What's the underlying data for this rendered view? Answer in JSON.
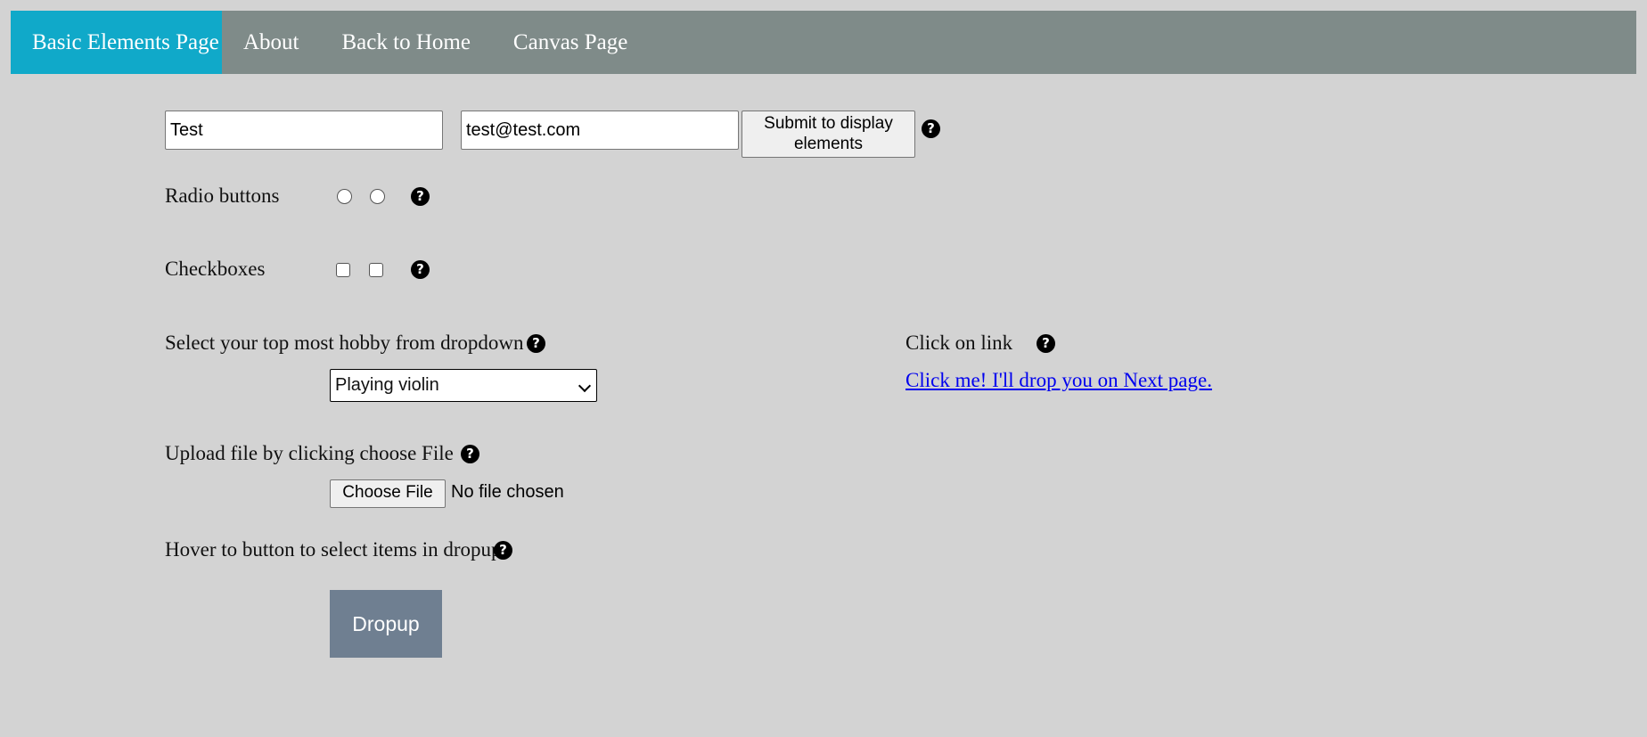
{
  "nav": {
    "items": [
      {
        "label": "Basic Elements Page",
        "active": true
      },
      {
        "label": "About"
      },
      {
        "label": "Back to Home"
      },
      {
        "label": "Canvas Page"
      }
    ]
  },
  "form": {
    "name_value": "Test",
    "email_value": "test@test.com",
    "submit_label": "Submit to display elements"
  },
  "radio": {
    "label": "Radio buttons"
  },
  "checkbox": {
    "label": "Checkboxes"
  },
  "hobby": {
    "label": "Select your top most hobby from dropdown",
    "selected": "Playing violin"
  },
  "link_section": {
    "label": "Click on link",
    "link_text": "Click me! I'll drop you on Next page."
  },
  "upload": {
    "label": "Upload file by clicking choose File",
    "button_label": "Choose File",
    "status": "No file chosen"
  },
  "hover": {
    "label": "Hover to button to select items in dropup",
    "button_label": "Dropup"
  },
  "icons": {
    "help_glyph": "?"
  },
  "colors": {
    "nav_bg": "#7f8b89",
    "nav_active": "#10a9c9",
    "page_bg": "#d3d3d3",
    "dropup_bg": "#6f7f91",
    "link": "#0000ee"
  }
}
